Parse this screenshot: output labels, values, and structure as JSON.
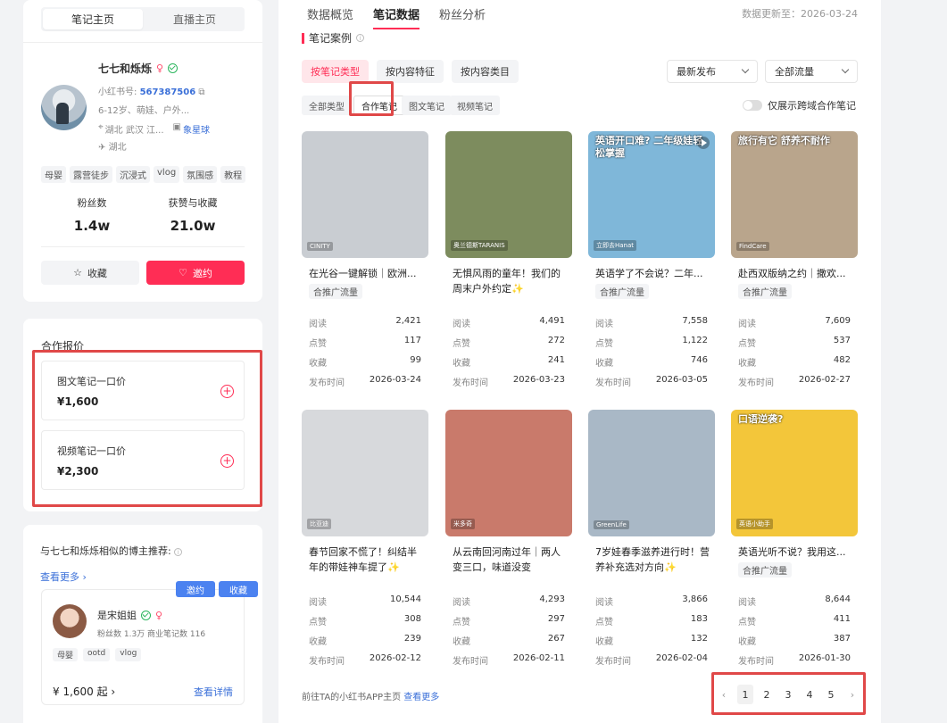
{
  "left": {
    "tabs": [
      "笔记主页",
      "直播主页"
    ],
    "profile": {
      "name": "七七和烁烁",
      "id_label": "小红书号:",
      "id": "567387506",
      "desc": "6-12岁、萌娃、户外...",
      "location": "湖北 武汉 江...",
      "brand": "象星球",
      "ip": "湖北",
      "tags": [
        "母婴",
        "露营徒步",
        "沉浸式",
        "vlog",
        "氛围感",
        "教程"
      ],
      "fans_label": "粉丝数",
      "fans": "1.4w",
      "likes_label": "获赞与收藏",
      "likes": "21.0w",
      "fav_btn": "收藏",
      "invite_btn": "邀约"
    },
    "pricing": {
      "title": "合作报价",
      "items": [
        {
          "name": "图文笔记一口价",
          "price": "¥1,600"
        },
        {
          "name": "视频笔记一口价",
          "price": "¥2,300"
        }
      ]
    },
    "similar": {
      "title": "与七七和烁烁相似的博主推荐:",
      "see_more": "查看更多 ›",
      "item": {
        "name": "是宋姐姐",
        "stats": "粉丝数 1.3万    商业笔记数 116",
        "tags": [
          "母婴",
          "ootd",
          "vlog"
        ],
        "price": "¥ 1,600 起 ›",
        "detail": "查看详情",
        "invite": "邀约",
        "fav": "收藏"
      }
    }
  },
  "main": {
    "tabs": [
      "数据概览",
      "笔记数据",
      "粉丝分析"
    ],
    "active_tab": "笔记数据",
    "updated": "数据更新至：2026-03-24",
    "section": "笔记案例",
    "filters": [
      "按笔记类型",
      "按内容特征",
      "按内容类目"
    ],
    "sort": "最新发布",
    "traffic": "全部流量",
    "types": [
      "全部类型",
      "合作笔记",
      "图文笔记",
      "视频笔记"
    ],
    "toggle_label": "仅展示跨域合作笔记",
    "labels": {
      "read": "阅读",
      "like": "点赞",
      "fav": "收藏",
      "date": "发布时间"
    },
    "notes": [
      {
        "title": "在光谷一键解锁｜欧洲...",
        "badge": "合推广流量",
        "read": "2,421",
        "like": "117",
        "fav": "99",
        "date": "2026-03-24",
        "wm": "CINITY",
        "bg": "#c9cdd2",
        "headline": ""
      },
      {
        "title": "无惧风雨的童年！我们的周末户外约定✨",
        "badge": "",
        "read": "4,491",
        "like": "272",
        "fav": "241",
        "date": "2026-03-23",
        "wm": "奥兰德斯TARANIS",
        "bg": "#7d8c5e",
        "headline": ""
      },
      {
        "title": "英语学了不会说？二年...",
        "badge": "合推广流量",
        "read": "7,558",
        "like": "1,122",
        "fav": "746",
        "date": "2026-03-05",
        "wm": "立即去Hanat",
        "bg": "#7fb7d9",
        "headline": "英语开口难? 二年级娃轻松掌握"
      },
      {
        "title": "赴西双版纳之约｜撒欢...",
        "badge": "合推广流量",
        "read": "7,609",
        "like": "537",
        "fav": "482",
        "date": "2026-02-27",
        "wm": "FindCare",
        "bg": "#b9a58c",
        "headline": "旅行有它 舒养不耐作"
      },
      {
        "title": "春节回家不慌了！纠结半年的带娃神车提了✨",
        "badge": "",
        "read": "10,544",
        "like": "308",
        "fav": "239",
        "date": "2026-02-12",
        "wm": "比亚迪",
        "bg": "#d7d9dc",
        "headline": ""
      },
      {
        "title": "从云南回河南过年｜两人变三口，味道没变",
        "badge": "",
        "read": "4,293",
        "like": "297",
        "fav": "267",
        "date": "2026-02-11",
        "wm": "米多奇",
        "bg": "#c97a6b",
        "headline": ""
      },
      {
        "title": "7岁娃春季滋养进行时！营养补充选对方向✨",
        "badge": "",
        "read": "3,866",
        "like": "183",
        "fav": "132",
        "date": "2026-02-04",
        "wm": "GreenLife",
        "bg": "#a9b8c6",
        "headline": ""
      },
      {
        "title": "英语光听不说？我用这...",
        "badge": "合推广流量",
        "read": "8,644",
        "like": "411",
        "fav": "387",
        "date": "2026-01-30",
        "wm": "英语小助手",
        "bg": "#f3c63a",
        "headline": "口语逆袭?"
      }
    ],
    "footer": "前往TA的小红书APP主页",
    "footer_link": "查看更多",
    "pages": [
      "1",
      "2",
      "3",
      "4",
      "5"
    ]
  }
}
